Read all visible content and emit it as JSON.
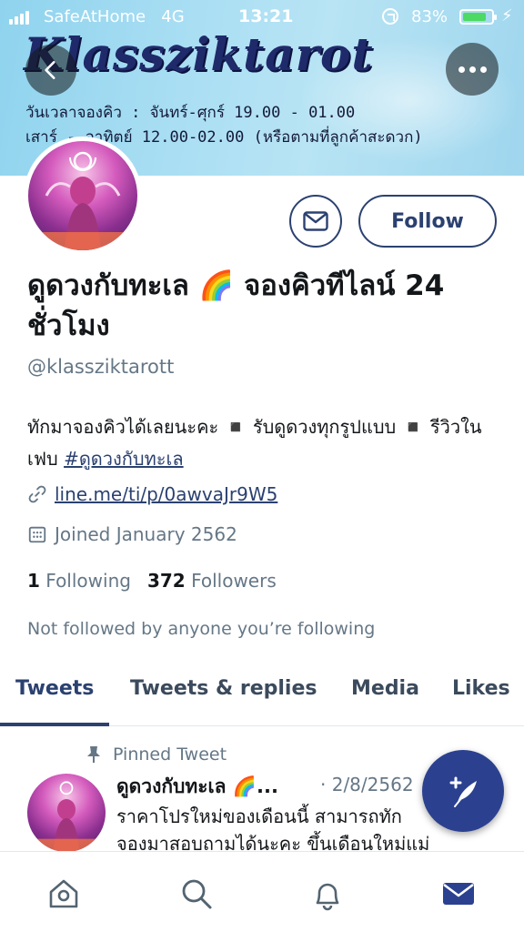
{
  "status_bar": {
    "carrier": "SafeAtHome",
    "network": "4G",
    "time": "13:21",
    "battery": "83%",
    "battery_level": 0.83,
    "battery_color": "#4cd964"
  },
  "header": {
    "back_icon": "chevron-left-icon",
    "more_icon": "more-horizontal-icon"
  },
  "banner": {
    "brand": "Klassziktarot",
    "line1": "วันเวลาจองคิว : จันทร์-ศุกร์ 19.00 - 01.00",
    "line2": "เสาร์ - อาทิตย์ 12.00-02.00 (หรือตามที่ลูกค้าสะดวก)"
  },
  "profile": {
    "display_name": "ดูดวงกับทะเล 🌈 จองคิวทีไลน์ 24 ชั่วโมง",
    "handle": "@klassziktarott",
    "bio_text": "ทักมาจองคิวได้เลยนะคะ ◾️ รับดูดวงทุกรูปแบบ ◾️ รีวิวในเฟบ ",
    "bio_hashtag": "#ดูดวงกับทะเล",
    "link": "line.me/ti/p/0awvaJr9W5",
    "joined": "Joined January 2562",
    "following_count": "1",
    "following_label": "Following",
    "followers_count": "372",
    "followers_label": "Followers",
    "not_followed": "Not followed by anyone you’re following",
    "follow_label": "Follow",
    "accent_color": "#2b4170"
  },
  "tabs": [
    {
      "label": "Tweets",
      "active": true
    },
    {
      "label": "Tweets & replies",
      "active": false
    },
    {
      "label": "Media",
      "active": false
    },
    {
      "label": "Likes",
      "active": false
    }
  ],
  "pinned_tweet": {
    "pinned_label": "Pinned Tweet",
    "author": "ดูดวงกับทะเล 🌈...",
    "date": "· 2/8/2562",
    "text_line1": "ราคาโปรใหม่ของเดือนนี้ สามารถทัก",
    "text_line2": "จองมาสอบถามได้นะคะ ขึ้นเดือนใหม่แม่"
  },
  "bottom_nav": [
    {
      "name": "home-icon",
      "active": false
    },
    {
      "name": "search-icon",
      "active": false
    },
    {
      "name": "notifications-icon",
      "active": false
    },
    {
      "name": "messages-icon",
      "active": true
    }
  ],
  "fab": {
    "icon": "compose-tweet-icon",
    "color": "#2b4190"
  }
}
